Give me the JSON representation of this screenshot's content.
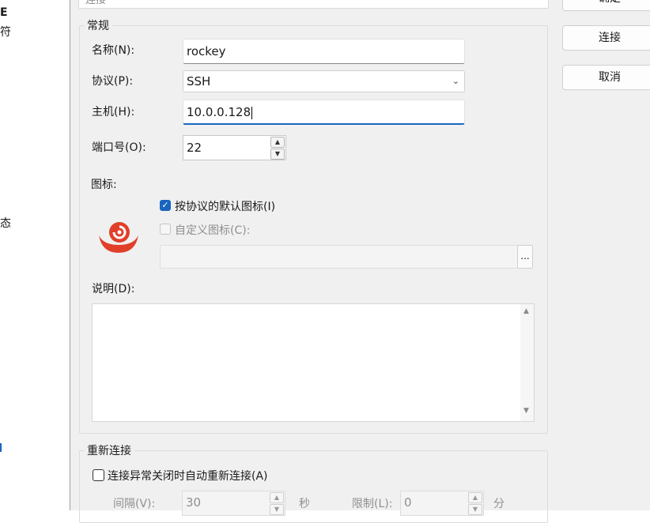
{
  "left_fragments": [
    "E",
    "符",
    "态"
  ],
  "dialog": {
    "top_fragment": "连接",
    "buttons": {
      "ok": "确定",
      "connect": "连接",
      "cancel": "取消"
    },
    "general": {
      "title": "常规",
      "name_label": "名称(N):",
      "name_value": "rockey",
      "protocol_label": "协议(P):",
      "protocol_value": "SSH",
      "host_label": "主机(H):",
      "host_value": "10.0.0.128",
      "port_label": "端口号(O):",
      "port_value": "22",
      "icon_label": "图标:",
      "default_icon_label": "按协议的默认图标(I)",
      "default_icon_checked": true,
      "custom_icon_label": "自定义图标(C):",
      "custom_icon_checked": false,
      "browse_label": "...",
      "desc_label": "说明(D):",
      "desc_value": ""
    },
    "reconnect": {
      "title": "重新连接",
      "auto_label": "连接异常关闭时自动重新连接(A)",
      "auto_checked": false,
      "interval_label": "间隔(V):",
      "interval_value": "30",
      "interval_unit": "秒",
      "limit_label": "限制(L):",
      "limit_value": "0",
      "limit_unit": "分"
    }
  },
  "colors": {
    "accent": "#1a64c0",
    "icon": "#e0402a"
  }
}
